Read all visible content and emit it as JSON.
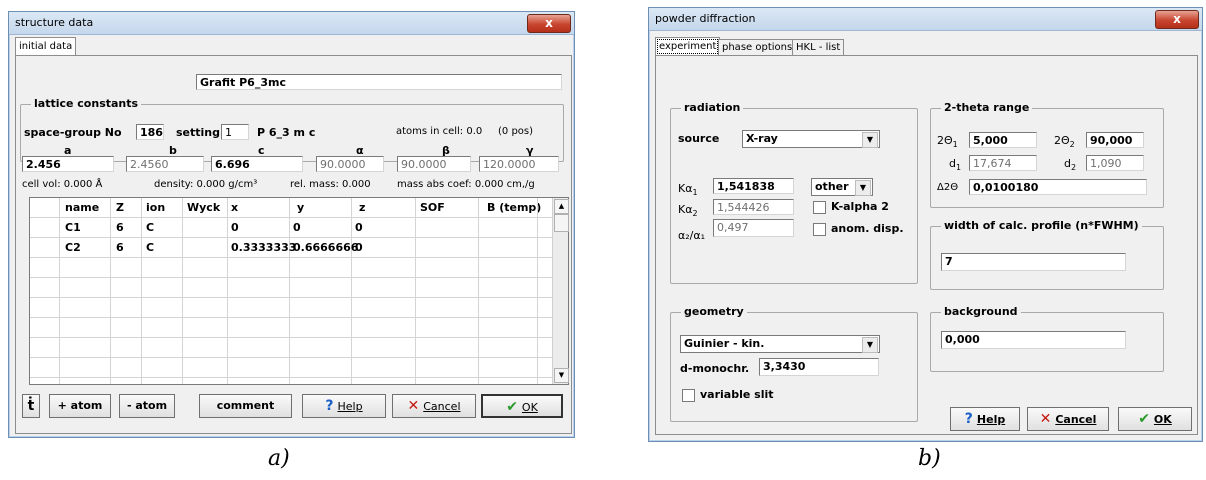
{
  "colors": {
    "help_icon": "#1a5fc8",
    "cancel_icon": "#c41a10",
    "ok_icon": "#2a9a2a",
    "close_button": "#c8452f"
  },
  "structure_window": {
    "title": "structure data",
    "close_label": "x",
    "tabs": [
      "initial data"
    ],
    "name_value": "Grafit P6_3mc",
    "lattice_group_label": "lattice constants",
    "spacegroup_label": "space-group No",
    "spacegroup_value": "186",
    "setting_label": "setting",
    "setting_value": "1",
    "spacegroup_symbol": "P 6_3 m c",
    "atoms_in_cell": "atoms in cell: 0.0",
    "atoms_pos": "(0 pos)",
    "param_headers": [
      "a",
      "b",
      "c",
      "α",
      "β",
      "γ"
    ],
    "param_values": [
      "2.456",
      "2.4560",
      "6.696",
      "90.0000",
      "90.0000",
      "120.0000"
    ],
    "cell_vol": "cell vol: 0.000 Å",
    "density": "density: 0.000 g/cm³",
    "rel_mass": "rel. mass: 0.000",
    "mass_abs": "mass abs coef: 0.000 cm,/g",
    "atom_table": {
      "headers": [
        "name",
        "Z",
        "ion",
        "Wyck",
        "x",
        "y",
        "z",
        "SOF",
        "B (temp)"
      ],
      "rows": [
        [
          "C1",
          "6",
          "C",
          "",
          "0",
          "0",
          "0",
          "",
          ""
        ],
        [
          "C2",
          "6",
          "C",
          "",
          "0.3333333",
          "0.6666666",
          "0",
          "",
          ""
        ]
      ]
    },
    "add_atom_label": "+ atom",
    "remove_atom_label": "- atom",
    "comment_label": "comment",
    "help_label": "Help",
    "cancel_label": "Cancel",
    "ok_label": "OK",
    "caption": "a)"
  },
  "powder_window": {
    "title": "powder diffraction",
    "close_label": "x",
    "tabs": [
      "experiment",
      "phase options",
      "HKL - list"
    ],
    "radiation_label": "radiation",
    "source_label": "source",
    "source_value": "X-ray",
    "ka1_label": "Kα",
    "ka1_sub": "1",
    "ka1_value": "1,541838",
    "ka2_label": "Kα",
    "ka2_sub": "2",
    "ka2_value": "1,544426",
    "ratio_label": "α₂/α₁",
    "ratio_value": "0,497",
    "line_value": "other",
    "kalpha2_label": "K-alpha 2",
    "anom_disp_label": "anom. disp.",
    "theta_range_label": "2-theta range",
    "theta1_label": "2Θ",
    "theta1_sub": "1",
    "theta1_value": "5,000",
    "theta2_label": "2Θ",
    "theta2_sub": "2",
    "theta2_value": "90,000",
    "d1_label": "d",
    "d1_sub": "1",
    "d1_value": "17,674",
    "d2_label": "d",
    "d2_sub": "2",
    "d2_value": "1,090",
    "step_label": "Δ2Θ",
    "step_value": "0,0100180",
    "profile_label": "width of calc. profile  (n*FWHM)",
    "profile_value": "7",
    "geometry_label": "geometry",
    "geometry_value": "Guinier - kin.",
    "dmono_label": "d-monochr.",
    "dmono_value": "3,3430",
    "variable_slit_label": "variable slit",
    "background_label": "background",
    "background_value": "0,000",
    "help_label": "Help",
    "cancel_label": "Cancel",
    "ok_label": "OK",
    "caption": "b)"
  }
}
